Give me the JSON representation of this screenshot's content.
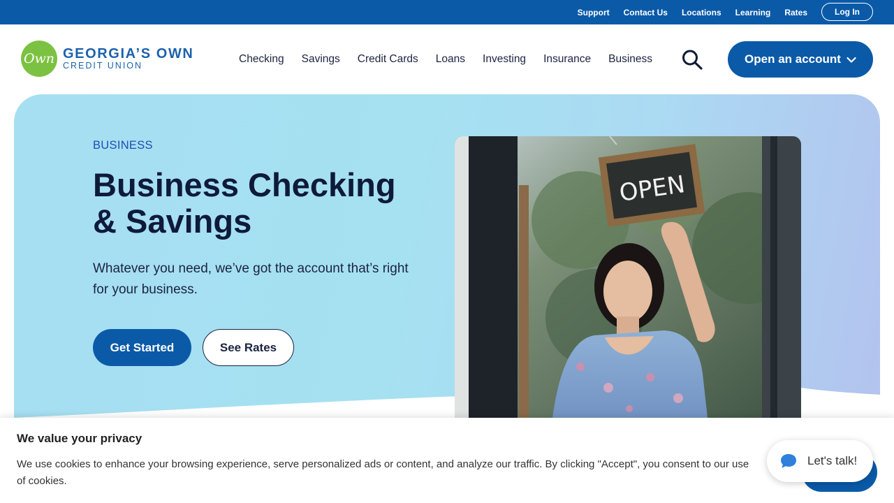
{
  "utility": {
    "links": [
      "Support",
      "Contact Us",
      "Locations",
      "Learning",
      "Rates"
    ],
    "login": "Log In"
  },
  "logo": {
    "mark": "Own",
    "line1": "GEORGIA’S OWN",
    "line2": "CREDIT UNION"
  },
  "nav": {
    "items": [
      "Checking",
      "Savings",
      "Credit Cards",
      "Loans",
      "Investing",
      "Insurance",
      "Business"
    ],
    "search_icon": "search-icon",
    "open_account": "Open an account"
  },
  "hero": {
    "eyebrow": "BUSINESS",
    "title": "Business Checking & Savings",
    "subtitle": "Whatever you need, we’ve got the account that’s right for your business.",
    "primary_cta": "Get Started",
    "secondary_cta": "See Rates",
    "sign_text": "OPEN"
  },
  "cookie": {
    "title": "We value your privacy",
    "text": "We use cookies to enhance your browsing experience, serve personalized ads or content, and analyze our traffic. By clicking \"Accept\", you consent to our use of cookies."
  },
  "chat": {
    "label": "Let's talk!"
  },
  "colors": {
    "brand_blue": "#0a5aa8",
    "logo_green": "#7cc242",
    "hero_bg": "#a5e1f1"
  }
}
